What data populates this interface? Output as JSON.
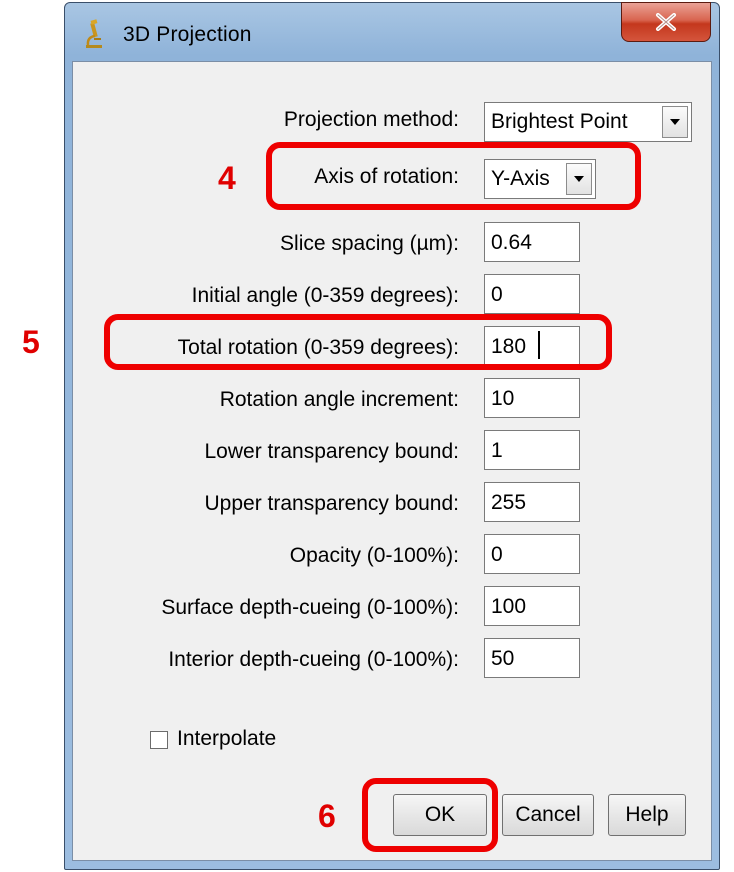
{
  "window": {
    "title": "3D Projection",
    "app_icon": "microscope-icon",
    "close_icon": "close-icon"
  },
  "form": {
    "projection_method": {
      "label": "Projection method:",
      "value": "Brightest Point"
    },
    "axis_of_rotation": {
      "label": "Axis of rotation:",
      "value": "Y-Axis"
    },
    "slice_spacing": {
      "label": "Slice spacing (µm):",
      "value": "0.64"
    },
    "initial_angle": {
      "label": "Initial angle (0-359 degrees):",
      "value": "0"
    },
    "total_rotation": {
      "label": "Total rotation (0-359 degrees):",
      "value": "180"
    },
    "rotation_increment": {
      "label": "Rotation angle increment:",
      "value": "10"
    },
    "lower_transparency": {
      "label": "Lower transparency bound:",
      "value": "1"
    },
    "upper_transparency": {
      "label": "Upper transparency bound:",
      "value": "255"
    },
    "opacity": {
      "label": "Opacity (0-100%):",
      "value": "0"
    },
    "surface_depth_cueing": {
      "label": "Surface depth-cueing (0-100%):",
      "value": "100"
    },
    "interior_depth_cueing": {
      "label": "Interior depth-cueing (0-100%):",
      "value": "50"
    },
    "interpolate": {
      "label": "Interpolate",
      "checked": false
    }
  },
  "buttons": {
    "ok": "OK",
    "cancel": "Cancel",
    "help": "Help"
  },
  "annotations": {
    "step4": "4",
    "step5": "5",
    "step6": "6",
    "color": "#ee0000"
  },
  "colors": {
    "frame": "#9cbde0",
    "client_bg": "#f0f0f0",
    "close_button": "#c4371d",
    "annotation": "#ee0000"
  }
}
